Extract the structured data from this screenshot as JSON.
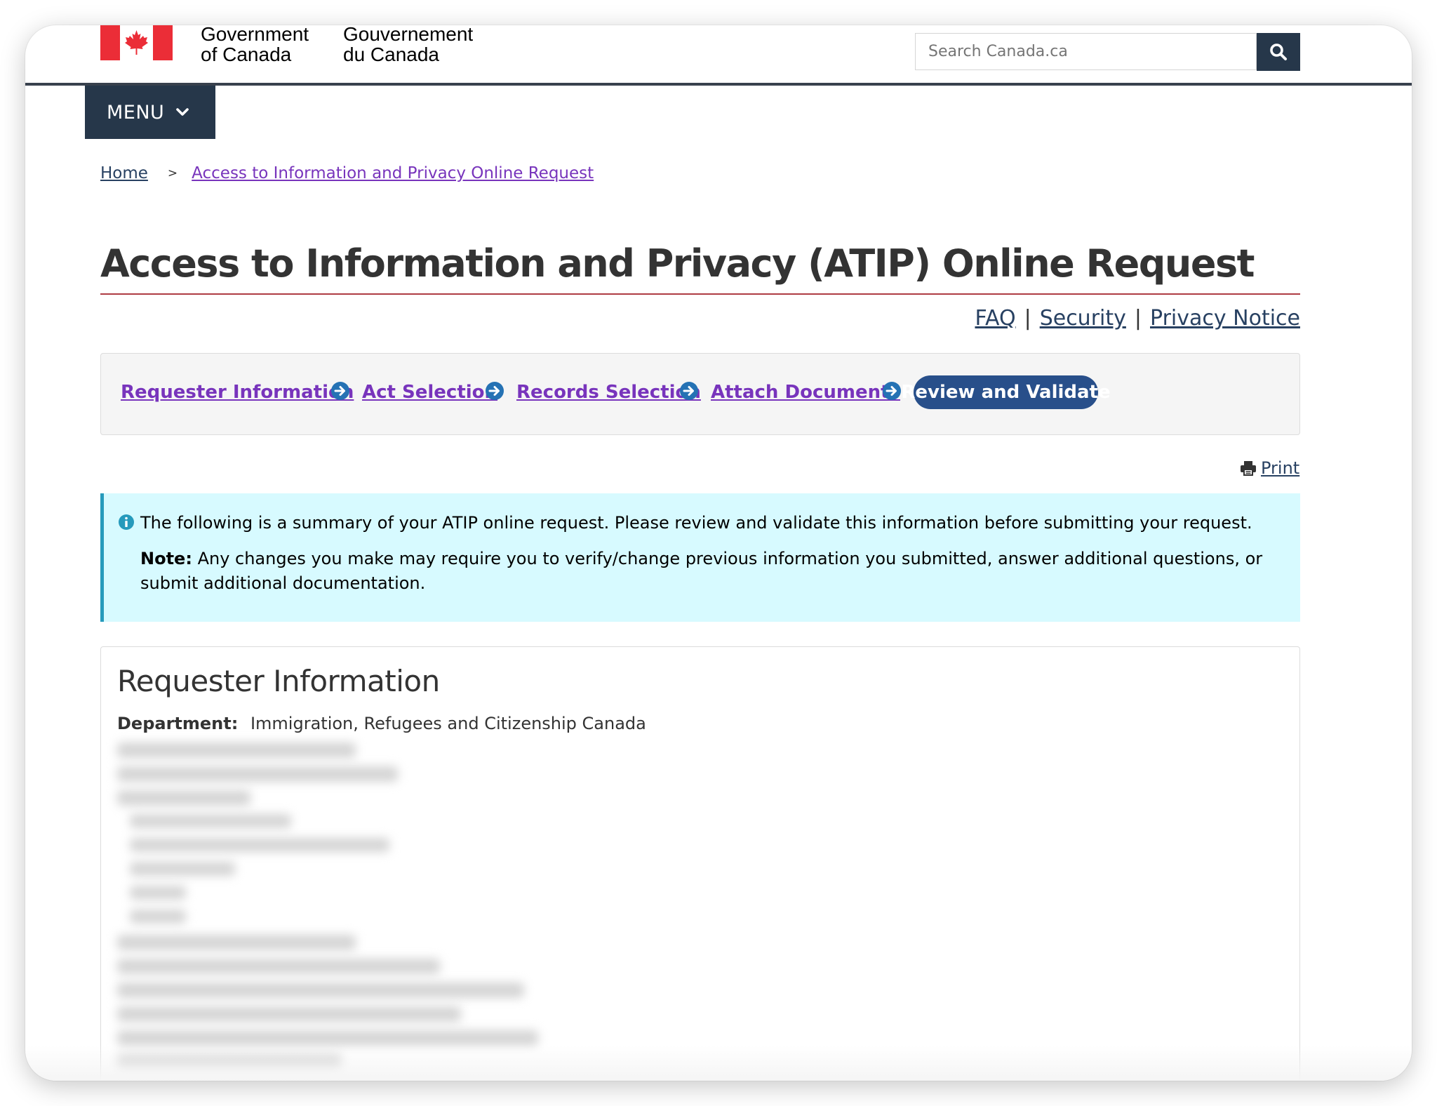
{
  "header": {
    "signature_en_line1": "Government",
    "signature_en_line2": "of Canada",
    "signature_fr_line1": "Gouvernement",
    "signature_fr_line2": "du Canada",
    "search_placeholder": "Search Canada.ca",
    "menu_label": "MENU"
  },
  "breadcrumb": {
    "home": "Home",
    "separator": ">",
    "current": "Access to Information and Privacy Online Request"
  },
  "page": {
    "title": "Access to Information and Privacy (ATIP) Online Request",
    "help_links": {
      "faq": "FAQ",
      "security": "Security",
      "privacy": "Privacy Notice",
      "separator": "|"
    },
    "print_label": "Print"
  },
  "steps": [
    {
      "label": "Requester Information"
    },
    {
      "label": "Act Selection"
    },
    {
      "label": "Records Selection"
    },
    {
      "label": "Attach Documents"
    },
    {
      "label": "Review and Validate",
      "current": true
    }
  ],
  "alert": {
    "summary": "The following is a summary of your ATIP online request. Please review and validate this information before submitting your request.",
    "note_label": "Note:",
    "note_text": "Any changes you make may require you to verify/change previous information you submitted, answer additional questions, or submit additional documentation."
  },
  "requester": {
    "title": "Requester Information",
    "department_label": "Department:",
    "department_value": "Immigration, Refugees and Citizenship Canada"
  },
  "colors": {
    "header_navy": "#26374a",
    "flag_red": "#eb2d37",
    "link_visited": "#7834bc",
    "link": "#284162",
    "current_step": "#284f8a",
    "alert_bg": "#d7faff",
    "alert_border": "#269abc",
    "title_rule": "#af3c43"
  },
  "icons": {
    "search": "search-icon",
    "menu_chevron": "chevron-down-icon",
    "step_arrow": "arrow-right-circle-icon",
    "print": "print-icon",
    "info": "info-icon",
    "flag": "maple-leaf-icon"
  }
}
